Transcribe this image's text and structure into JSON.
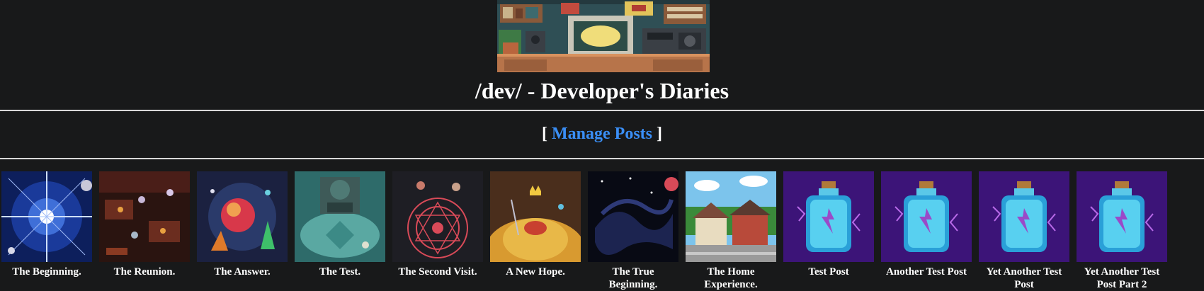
{
  "page": {
    "title": "/dev/ - Developer's Diaries",
    "manage_open": "[",
    "manage_label": "Manage Posts",
    "manage_close": "]"
  },
  "posts": [
    {
      "title": "The Beginning.",
      "icon": "starburst-space-image"
    },
    {
      "title": "The Reunion.",
      "icon": "tavern-scene-image"
    },
    {
      "title": "The Answer.",
      "icon": "glowing-orb-image"
    },
    {
      "title": "The Test.",
      "icon": "stone-guardian-image"
    },
    {
      "title": "The Second Visit.",
      "icon": "magic-circle-image"
    },
    {
      "title": "A New Hope.",
      "icon": "gold-hoard-image"
    },
    {
      "title": "The True Beginning.",
      "icon": "dark-void-image"
    },
    {
      "title": "The Home Experience.",
      "icon": "suburban-houses-image"
    },
    {
      "title": "Test Post",
      "icon": "potion-bottle-image"
    },
    {
      "title": "Another Test Post",
      "icon": "potion-bottle-image"
    },
    {
      "title": "Yet Another Test Post",
      "icon": "potion-bottle-image"
    },
    {
      "title": "Yet Another Test Post Part 2",
      "icon": "potion-bottle-image"
    }
  ],
  "colors": {
    "background": "#18191a",
    "link": "#3a8ef5",
    "text": "#ffffff"
  }
}
